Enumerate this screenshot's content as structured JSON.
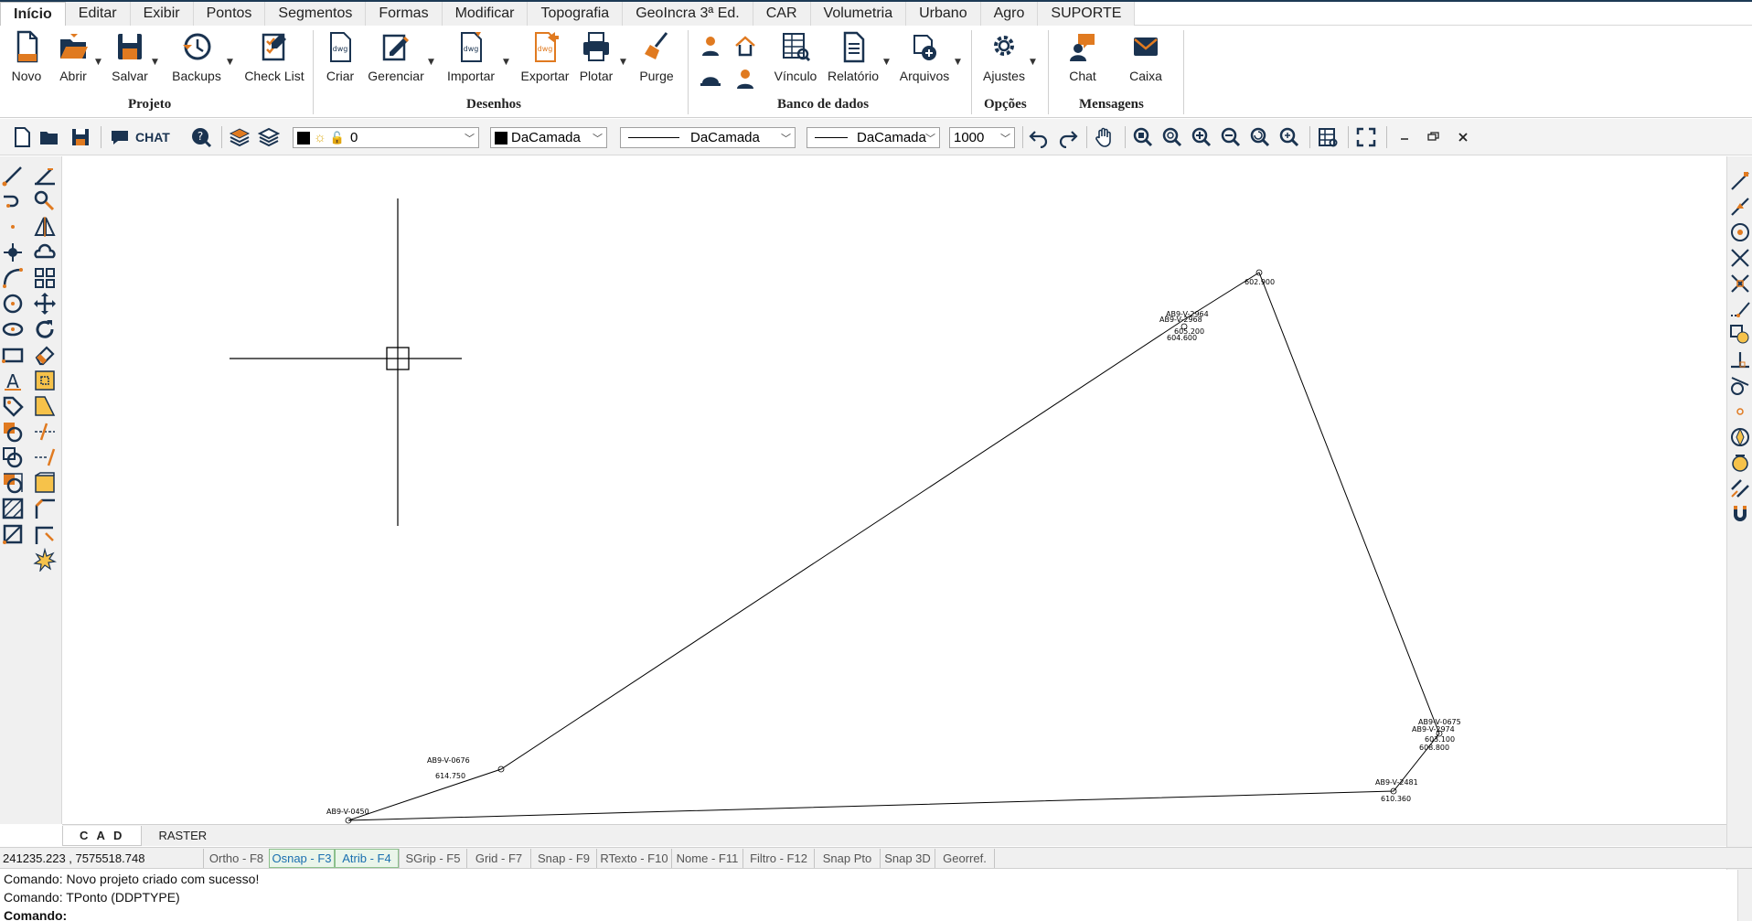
{
  "menu": {
    "tabs": [
      "Início",
      "Editar",
      "Exibir",
      "Pontos",
      "Segmentos",
      "Formas",
      "Modificar",
      "Topografia",
      "GeoIncra 3ª Ed.",
      "CAR",
      "Volumetria",
      "Urbano",
      "Agro",
      "SUPORTE"
    ]
  },
  "ribbon": {
    "projeto": {
      "label": "Projeto",
      "buttons": [
        "Novo",
        "Abrir",
        "Salvar",
        "Backups",
        "Check List"
      ]
    },
    "desenhos": {
      "label": "Desenhos",
      "buttons": [
        "Criar",
        "Gerenciar",
        "Importar",
        "Exportar",
        "Plotar",
        "Purge"
      ]
    },
    "banco": {
      "label": "Banco de dados",
      "buttons": [
        "Vínculo",
        "Relatório",
        "Arquivos"
      ]
    },
    "opcoes": {
      "label": "Opções",
      "buttons": [
        "Ajustes"
      ]
    },
    "mensagens": {
      "label": "Mensagens",
      "buttons": [
        "Chat",
        "Caixa"
      ]
    }
  },
  "toolbar": {
    "chat_label": "CHAT",
    "layer_value": "0",
    "color_value": "DaCamada",
    "linetype_value": "DaCamada",
    "lineweight_value": "DaCamada",
    "scale_value": "1000"
  },
  "drawing": {
    "labels": [
      {
        "name": "AB9-V-2964",
        "value": "605.200"
      },
      {
        "name": "AB9-V-2968",
        "value": "604.600"
      },
      {
        "name": "",
        "value": "602.900"
      },
      {
        "name": "AB9-V-0675",
        "value": "603.100"
      },
      {
        "name": "AB9-V-2974",
        "value": "608.800"
      },
      {
        "name": "AB9-V-2481",
        "value": "610.360"
      },
      {
        "name": "AB9-V-0676",
        "value": "614.750"
      },
      {
        "name": "AB9-V-0450",
        "value": ""
      }
    ]
  },
  "model_tabs": [
    "C A D",
    "RASTER"
  ],
  "status": {
    "coords": "241235.223 , 7575518.748",
    "toggles": [
      "Ortho - F8",
      "Osnap - F3",
      "Atrib - F4",
      "SGrip - F5",
      "Grid - F7",
      "Snap - F9",
      "RTexto - F10",
      "Nome - F11",
      "Filtro - F12",
      "Snap Pto",
      "Snap 3D",
      "Georref."
    ]
  },
  "command": {
    "lines": [
      "Comando: Novo projeto criado com sucesso!",
      "Comando: TPonto (DDPTYPE)"
    ],
    "prompt": "Comando:"
  },
  "colors": {
    "accent": "#1d3a55",
    "icon_orange": "#e07a20",
    "icon_navy": "#1a3350",
    "osnap_on": "#1a6fb0"
  }
}
